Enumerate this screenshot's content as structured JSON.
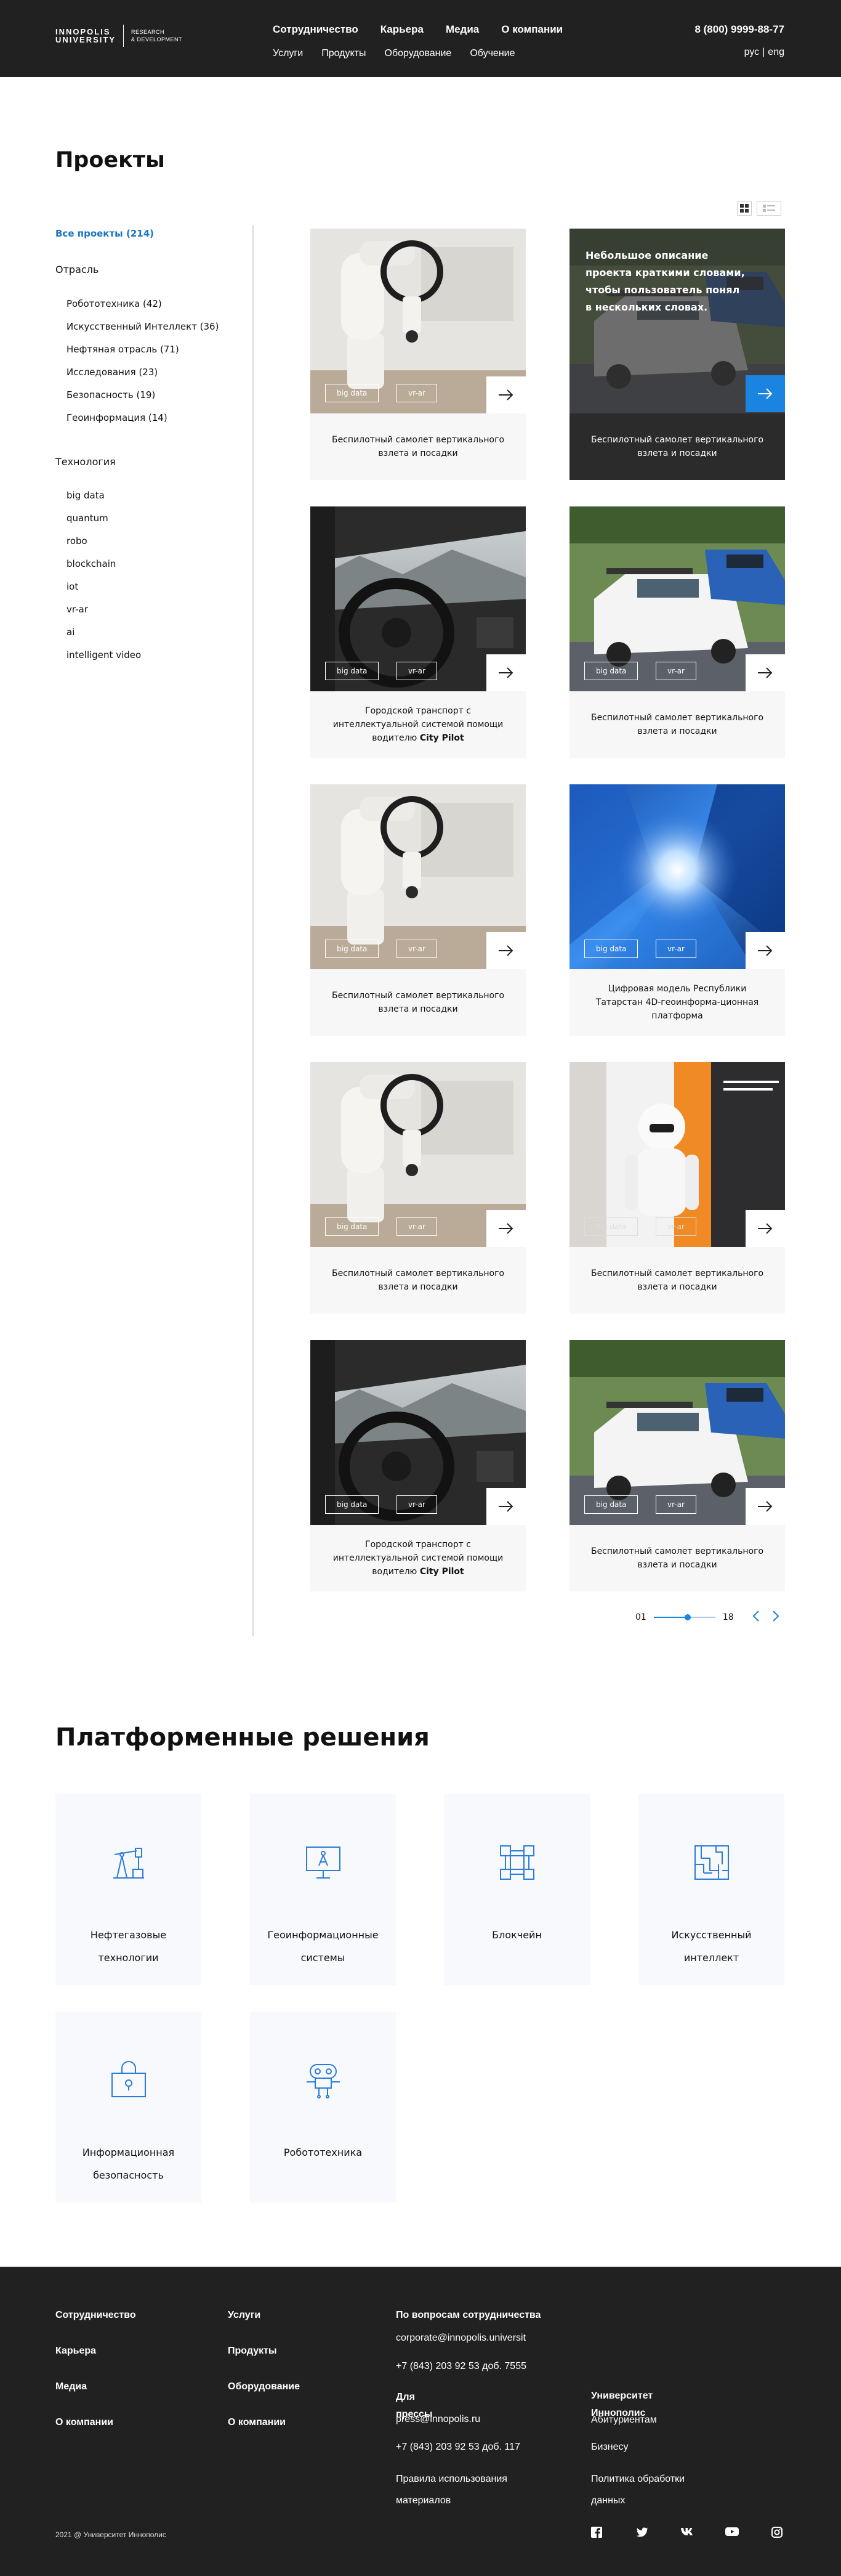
{
  "header": {
    "logo_main_line1": "Innopolis",
    "logo_main_line2": "University",
    "logo_sub_line1": "Research",
    "logo_sub_line2": "& Development",
    "nav_primary": [
      "Сотрудничество",
      "Карьера",
      "Медиа",
      "О компании"
    ],
    "nav_secondary": [
      "Услуги",
      "Продукты",
      "Оборудование",
      "Обучение"
    ],
    "phone": "8 (800) 9999-88-77",
    "lang_ru": "рус",
    "lang_sep": "|",
    "lang_en": "eng"
  },
  "page": {
    "title": "Проекты"
  },
  "sidebar": {
    "all_projects": "Все проекты (214)",
    "industry_heading": "Отрасль",
    "industry_items": [
      "Робототехника (42)",
      "Искусственный Интеллект (36)",
      "Нефтяная отрасль (71)",
      "Исследования (23)",
      "Безопасность (19)",
      "Геоинформация (14)"
    ],
    "tech_heading": "Технология",
    "tech_items": [
      "big data",
      "quantum",
      "robo",
      "blockchain",
      "iot",
      "vr-ar",
      "ai",
      "intelligent video"
    ]
  },
  "cards": [
    {
      "caption": "Беспилотный самолет вертикального взлета и посадки",
      "tags": [
        "big data",
        "vr-ar"
      ],
      "image": "robot-arm"
    },
    {
      "description": "Небольшое описание проекта краткими словами, чтобы пользователь понял в нескольких словах.",
      "caption": "Беспилотный самолет вертикального взлета и посадки",
      "image": "cars-dark"
    },
    {
      "caption_main": "Городской транспорт с интеллектуальной системой помощи водителю",
      "caption_bold": "City Pilot",
      "tags": [
        "big data",
        "vr-ar"
      ],
      "image": "car-interior"
    },
    {
      "caption": "Беспилотный самолет вертикального взлета и посадки",
      "tags": [
        "big data",
        "vr-ar"
      ],
      "image": "cars"
    },
    {
      "caption": "Беспилотный самолет вертикального взлета и посадки",
      "tags": [
        "big data",
        "vr-ar"
      ],
      "image": "robot-arm"
    },
    {
      "caption": "Цифровая модель Республики Татарстан 4D-геоинформа-ционная платформа",
      "tags": [
        "big data",
        "vr-ar"
      ],
      "image": "digital-city"
    },
    {
      "caption": "Беспилотный самолет вертикального взлета и посадки",
      "tags": [
        "big data",
        "vr-ar"
      ],
      "image": "robot-arm"
    },
    {
      "caption": "Беспилотный самолет вертикального взлета и посадки",
      "tags": [
        "big data",
        "vr-ar"
      ],
      "image": "humanoid-robot"
    },
    {
      "caption_main": "Городской транспорт с интеллектуальной системой помощи водителю",
      "caption_bold": "City Pilot",
      "tags": [
        "big data",
        "vr-ar"
      ],
      "image": "car-interior"
    },
    {
      "caption": "Беспилотный самолет вертикального взлета и посадки",
      "tags": [
        "big data",
        "vr-ar"
      ],
      "image": "cars"
    }
  ],
  "pagination": {
    "current": "01",
    "total": "18",
    "progress": 0.55
  },
  "platform": {
    "title": "Платформенные решения",
    "items": [
      {
        "label": "Нефтегазовые технологии",
        "icon": "oil-pump-icon"
      },
      {
        "label": "Геоинформационные системы",
        "icon": "monitor-compass-icon"
      },
      {
        "label": "Блокчейн",
        "icon": "blockchain-icon"
      },
      {
        "label": "Искусственный интеллект",
        "icon": "maze-icon"
      },
      {
        "label": "Информационная безопасность",
        "icon": "lock-icon"
      },
      {
        "label": "Робототехника",
        "icon": "robot-icon"
      }
    ]
  },
  "footer": {
    "col1": [
      "Сотрудничество",
      "Карьера",
      "Медиа",
      "О компании"
    ],
    "col2": [
      "Услуги",
      "Продукты",
      "Оборудование",
      "О компании"
    ],
    "coop_heading": "По вопросам сотрудничества",
    "coop_email": "corporate@innopolis.universit",
    "coop_phone": "+7 (843) 203 92 53 доб. 7555",
    "press_heading": "Для прессы",
    "press_email": "press@innopolis.ru",
    "press_phone": "+7 (843) 203 92 53 доб. 117",
    "terms": "Правила использования материалов",
    "univ_heading": "Университет Иннополис",
    "univ_links": [
      "Абитуриентам",
      "Бизнесу",
      "Политика обработки данных"
    ],
    "copyright": "2021 @ Университет Иннополис",
    "social": [
      "facebook-icon",
      "twitter-icon",
      "vk-icon",
      "youtube-icon",
      "instagram-icon"
    ]
  }
}
